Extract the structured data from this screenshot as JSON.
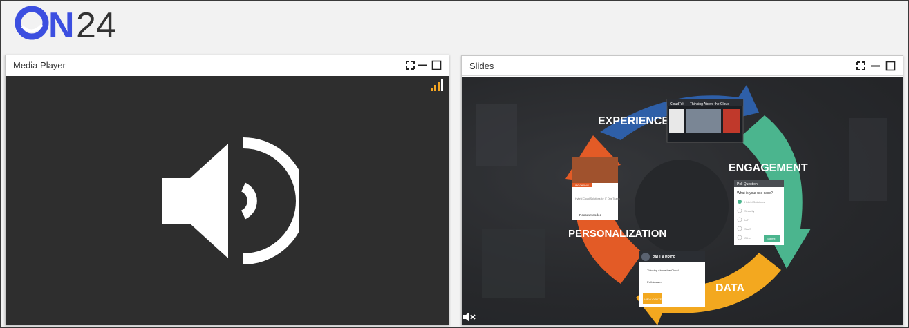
{
  "brand": {
    "logo_text": "ON24",
    "accent": "#3c4fe0"
  },
  "media_player": {
    "title": "Media Player",
    "icons": [
      "fullscreen-icon",
      "minimize-icon",
      "maximize-icon",
      "signal-strength-icon",
      "speaker-icon"
    ],
    "background": "#2e2e2e",
    "signal_color": "#f5a623"
  },
  "slides": {
    "title": "Slides",
    "icons": [
      "fullscreen-icon",
      "minimize-icon",
      "maximize-icon",
      "mute-icon"
    ],
    "cycle": {
      "segments": [
        "EXPERIENCES",
        "ENGAGEMENT",
        "DATA",
        "PERSONALIZATION"
      ],
      "colors": {
        "experiences": "#2e5fa8",
        "engagement": "#4bb58e",
        "data": "#f3a81f",
        "personalization": "#e35b26"
      }
    },
    "cards": {
      "webinar": {
        "logo": "CloudTek",
        "headline": "Thinking Above the Cloud"
      },
      "poll": {
        "title": "Poll Question",
        "question": "What is your use case?",
        "options": [
          "Hybrid Solutions",
          "Security",
          "IoT",
          "SaaS",
          "Other"
        ],
        "submit": "Submit"
      },
      "profile": {
        "name": "PAULA PRICE",
        "rows": [
          "Thinking Above the Cloud",
          "Poll Answer"
        ],
        "cta": "VIEW CONTENT"
      },
      "recommended": {
        "badge": "UPCOMING",
        "headline": "Hybrid Cloud Solutions for IT Ops Teams",
        "footer": "Recommended"
      }
    }
  }
}
